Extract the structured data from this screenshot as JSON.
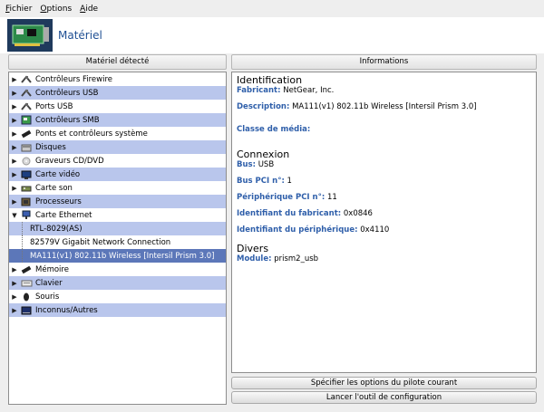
{
  "menubar": {
    "items": [
      {
        "accel": "F",
        "rest": "ichier"
      },
      {
        "accel": "O",
        "rest": "ptions"
      },
      {
        "accel": "A",
        "rest": "ide"
      }
    ]
  },
  "banner": {
    "title": "Matériel"
  },
  "left_panel": {
    "header": "Matériel détecté"
  },
  "right_panel": {
    "header": "Informations"
  },
  "tree": [
    {
      "label": "Contrôleurs Firewire",
      "icon": "firewire-icon"
    },
    {
      "label": "Contrôleurs USB",
      "icon": "usb-icon"
    },
    {
      "label": "Ports USB",
      "icon": "usb-port-icon"
    },
    {
      "label": "Contrôleurs SMB",
      "icon": "smb-icon"
    },
    {
      "label": "Ponts et contrôleurs système",
      "icon": "bridge-icon"
    },
    {
      "label": "Disques",
      "icon": "disk-icon"
    },
    {
      "label": "Graveurs CD/DVD",
      "icon": "cd-icon"
    },
    {
      "label": "Carte vidéo",
      "icon": "video-card-icon"
    },
    {
      "label": "Carte son",
      "icon": "sound-card-icon"
    },
    {
      "label": "Processeurs",
      "icon": "processor-icon"
    },
    {
      "label": "Carte Ethernet",
      "icon": "ethernet-icon"
    },
    {
      "label": "RTL-8029(AS)"
    },
    {
      "label": "82579V Gigabit Network Connection"
    },
    {
      "label": "MA111(v1) 802.11b Wireless [Intersil Prism 3.0]"
    },
    {
      "label": "Mémoire",
      "icon": "memory-icon"
    },
    {
      "label": "Clavier",
      "icon": "keyboard-icon"
    },
    {
      "label": "Souris",
      "icon": "mouse-icon"
    },
    {
      "label": "Inconnus/Autres",
      "icon": "unknown-icon"
    }
  ],
  "info": {
    "identification": {
      "title": "Identification",
      "fabricant_k": "Fabricant:",
      "fabricant_v": "NetGear, Inc.",
      "description_k": "Description:",
      "description_v": "MA111(v1) 802.11b Wireless [Intersil Prism 3.0]",
      "classe_k": "Classe de média:"
    },
    "connexion": {
      "title": "Connexion",
      "bus_k": "Bus:",
      "bus_v": "USB",
      "buspci_k": "Bus PCI n°:",
      "buspci_v": "1",
      "periph_k": "Périphérique PCI n°:",
      "periph_v": "11",
      "idfab_k": "Identifiant du fabricant:",
      "idfab_v": "0x0846",
      "idper_k": "Identifiant du périphérique:",
      "idper_v": "0x4110"
    },
    "divers": {
      "title": "Divers",
      "module_k": "Module:",
      "module_v": "prism2_usb"
    }
  },
  "buttons": {
    "driver_options": "Spécifier les options du pilote courant",
    "config_tool": "Lancer l'outil de configuration"
  }
}
